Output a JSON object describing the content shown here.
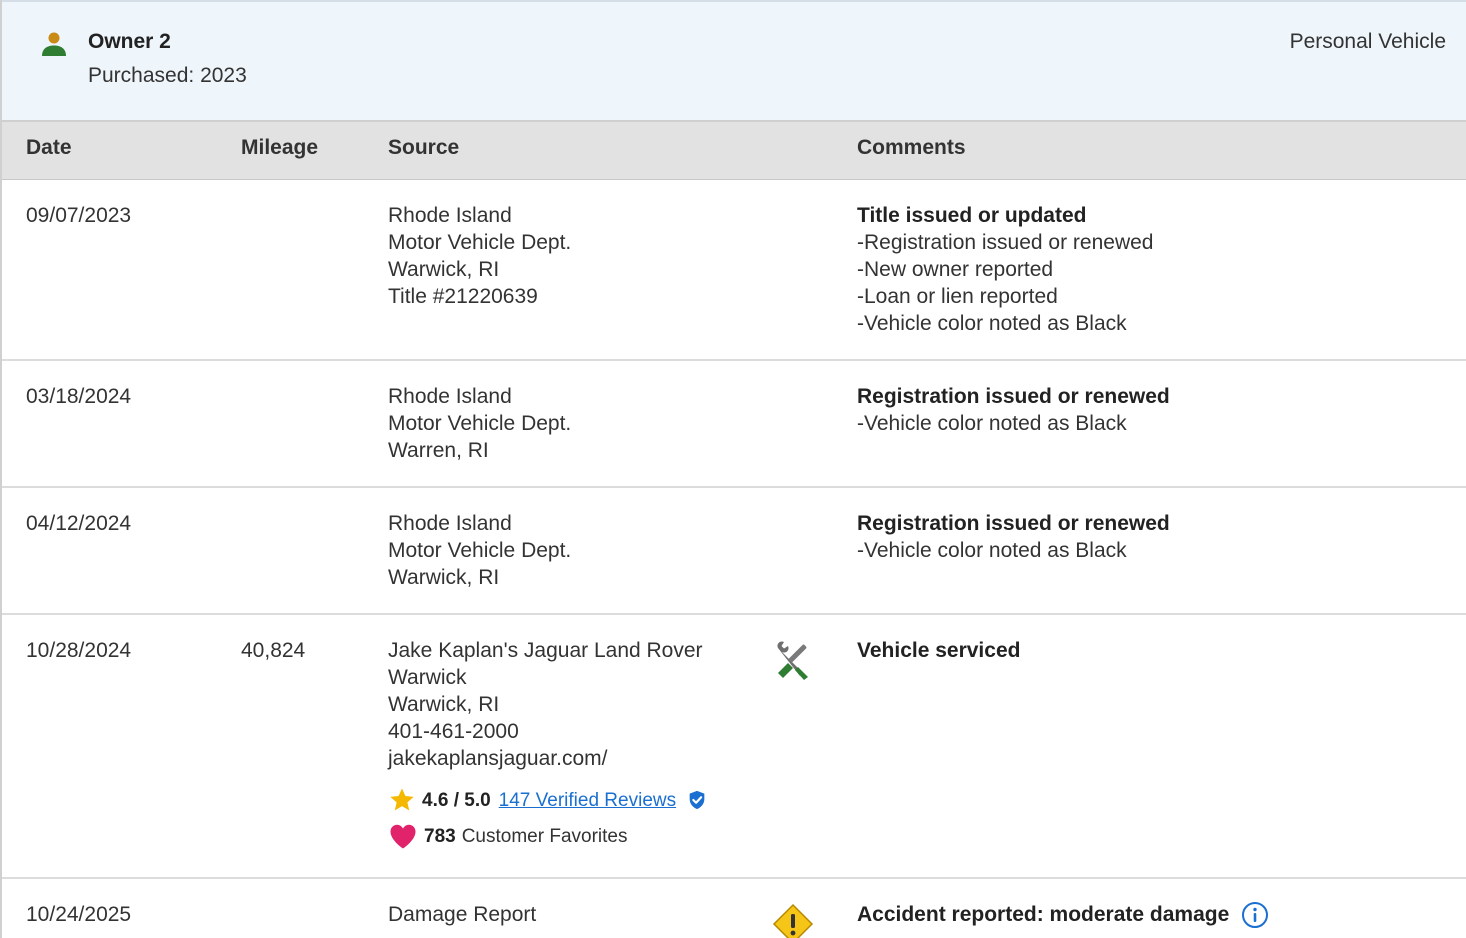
{
  "owner": {
    "name": "Owner 2",
    "purchased": "Purchased: 2023",
    "type": "Personal Vehicle",
    "icon": "person-icon",
    "icon_color": "#2e7d32"
  },
  "table": {
    "headers": {
      "date": "Date",
      "mileage": "Mileage",
      "source": "Source",
      "comments": "Comments"
    },
    "rows": [
      {
        "date": "09/07/2023",
        "mileage": "",
        "source": [
          "Rhode Island",
          "Motor Vehicle Dept.",
          "Warwick, RI",
          "Title #21220639"
        ],
        "comment_title": "Title issued or updated",
        "comment_items": [
          "Registration issued or renewed",
          "New owner reported",
          "Loan or lien reported",
          "Vehicle color noted as Black"
        ]
      },
      {
        "date": "03/18/2024",
        "mileage": "",
        "source": [
          "Rhode Island",
          "Motor Vehicle Dept.",
          "Warren, RI"
        ],
        "comment_title": "Registration issued or renewed",
        "comment_items": [
          "Vehicle color noted as Black"
        ]
      },
      {
        "date": "04/12/2024",
        "mileage": "",
        "source": [
          "Rhode Island",
          "Motor Vehicle Dept.",
          "Warwick, RI"
        ],
        "comment_title": "Registration issued or renewed",
        "comment_items": [
          "Vehicle color noted as Black"
        ]
      },
      {
        "date": "10/28/2024",
        "mileage": "40,824",
        "source": [
          "Jake Kaplan's Jaguar Land Rover",
          "Warwick",
          "Warwick, RI",
          "401-461-2000",
          "jakekaplansjaguar.com/"
        ],
        "rating": "4.6 / 5.0",
        "reviews_link": "147 Verified Reviews",
        "favorites_count": "783",
        "favorites_label": "Customer Favorites",
        "icon": "service-tools-icon",
        "comment_title": "Vehicle serviced",
        "comment_items": []
      },
      {
        "date": "10/24/2025",
        "mileage": "",
        "source": [
          "Damage Report"
        ],
        "icon": "warning-icon",
        "comment_title": "Accident reported: moderate damage",
        "comment_items": []
      }
    ]
  },
  "colors": {
    "header_bg": "#eef5fb",
    "table_head_bg": "#e2e2e2",
    "link": "#1a6fd1",
    "star": "#f5b800",
    "heart": "#e0236b",
    "warning": "#f5c518",
    "verified": "#1a6fd1"
  }
}
